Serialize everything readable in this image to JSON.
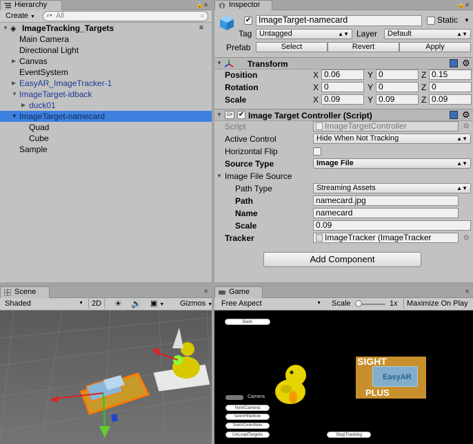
{
  "hierarchy": {
    "tab": "Hierarchy",
    "create_label": "Create",
    "search_placeholder": "All",
    "scene_name": "ImageTracking_Targets",
    "items": [
      {
        "label": "Main Camera"
      },
      {
        "label": "Directional Light"
      },
      {
        "label": "Canvas"
      },
      {
        "label": "EventSystem"
      },
      {
        "label": "EasyAR_ImageTracker-1"
      },
      {
        "label": "ImageTarget-idback"
      },
      {
        "label": "duck01"
      },
      {
        "label": "ImageTarget-namecard"
      },
      {
        "label": "Quad"
      },
      {
        "label": "Cube"
      },
      {
        "label": "Sample"
      }
    ]
  },
  "inspector": {
    "tab": "Inspector",
    "object_name": "ImageTarget-namecard",
    "static_label": "Static",
    "tag_label": "Tag",
    "tag_value": "Untagged",
    "layer_label": "Layer",
    "layer_value": "Default",
    "prefab_label": "Prefab",
    "prefab_select": "Select",
    "prefab_revert": "Revert",
    "prefab_apply": "Apply",
    "transform": {
      "title": "Transform",
      "position_label": "Position",
      "rotation_label": "Rotation",
      "scale_label": "Scale",
      "x": "X",
      "y": "Y",
      "z": "Z",
      "position": [
        "0.06",
        "0",
        "0.15"
      ],
      "rotation": [
        "0",
        "0",
        "0"
      ],
      "scale": [
        "0.09",
        "0.09",
        "0.09"
      ]
    },
    "controller": {
      "title": "Image Target Controller (Script)",
      "script_label": "Script",
      "script_value": "ImageTargetController",
      "active_control_label": "Active Control",
      "active_control_value": "Hide When Not Tracking",
      "horizontal_flip_label": "Horizontal Flip",
      "source_type_label": "Source Type",
      "source_type_value": "Image File",
      "image_file_source_label": "Image File Source",
      "path_type_label": "Path Type",
      "path_type_value": "Streaming Assets",
      "path_label": "Path",
      "path_value": "namecard.jpg",
      "name_label": "Name",
      "name_value": "namecard",
      "scale_label": "Scale",
      "scale_value": "0.09",
      "tracker_label": "Tracker",
      "tracker_value": "ImageTracker (ImageTracker"
    },
    "add_component": "Add Component"
  },
  "scene": {
    "tab": "Scene",
    "shading": "Shaded",
    "mode_2d": "2D",
    "gizmos": "Gizmos"
  },
  "game": {
    "tab": "Game",
    "aspect": "Free Aspect",
    "scale_label": "Scale",
    "scale_value": "1x",
    "maximize": "Maximize On Play",
    "buttons": {
      "back": "Back",
      "camera": "Camera",
      "next_camera": "NextCamera",
      "switch_hflip": "SwitchHFlipMode",
      "switch_center": "SwitchCenterMode",
      "unload_targets": "UnLoadTargets",
      "stop_tracking": "StopTracking"
    },
    "card_top": "SIGHT",
    "card_brand": "EasyAR",
    "card_bottom": "PLUS"
  },
  "colors": {
    "selection": "#3d80df",
    "panel": "#c2c2c2",
    "prefab_text": "#1a3a95",
    "scene_bg": "#6b6b6b",
    "game_bg": "#000000",
    "duck": "#e6d400"
  }
}
